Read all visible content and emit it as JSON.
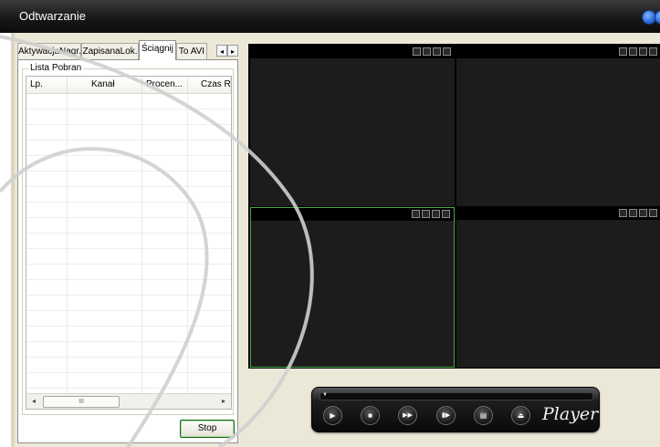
{
  "window": {
    "title": "Odtwarzanie"
  },
  "tabs": [
    {
      "label": "AktywacjaNagr.",
      "active": false
    },
    {
      "label": "ZapisanaLok.",
      "active": false
    },
    {
      "label": "Ściągnij",
      "active": true
    },
    {
      "label": "To AVI",
      "active": false
    }
  ],
  "tab_scroll": {
    "left": "◂",
    "right": "▸"
  },
  "download": {
    "group_label": "Lista Pobran",
    "columns": [
      "Lp.",
      "Kanał",
      "Procen...",
      "Czas R..."
    ],
    "rows": [],
    "scroll_left": "◂",
    "scroll_right": "▸",
    "scroll_grip": "III",
    "stop_label": "Stop"
  },
  "video_grid": {
    "cells": [
      {
        "selected": false
      },
      {
        "selected": false
      },
      {
        "selected": true
      },
      {
        "selected": false
      }
    ],
    "cell_icons": [
      "record-icon",
      "snapshot-icon",
      "audio-icon",
      "close-icon"
    ]
  },
  "player": {
    "brand": "Player",
    "buttons": [
      {
        "name": "play-button",
        "icon": "▶"
      },
      {
        "name": "stop-button",
        "icon": "■"
      },
      {
        "name": "fast-forward-button",
        "icon": "▶▶"
      },
      {
        "name": "step-forward-button",
        "icon": "▮▶"
      },
      {
        "name": "playlist-button",
        "icon": "▤"
      },
      {
        "name": "eject-button",
        "icon": "⏏"
      }
    ]
  },
  "colors": {
    "selected_cell_border": "#48a848",
    "title_bar": "#161616"
  }
}
